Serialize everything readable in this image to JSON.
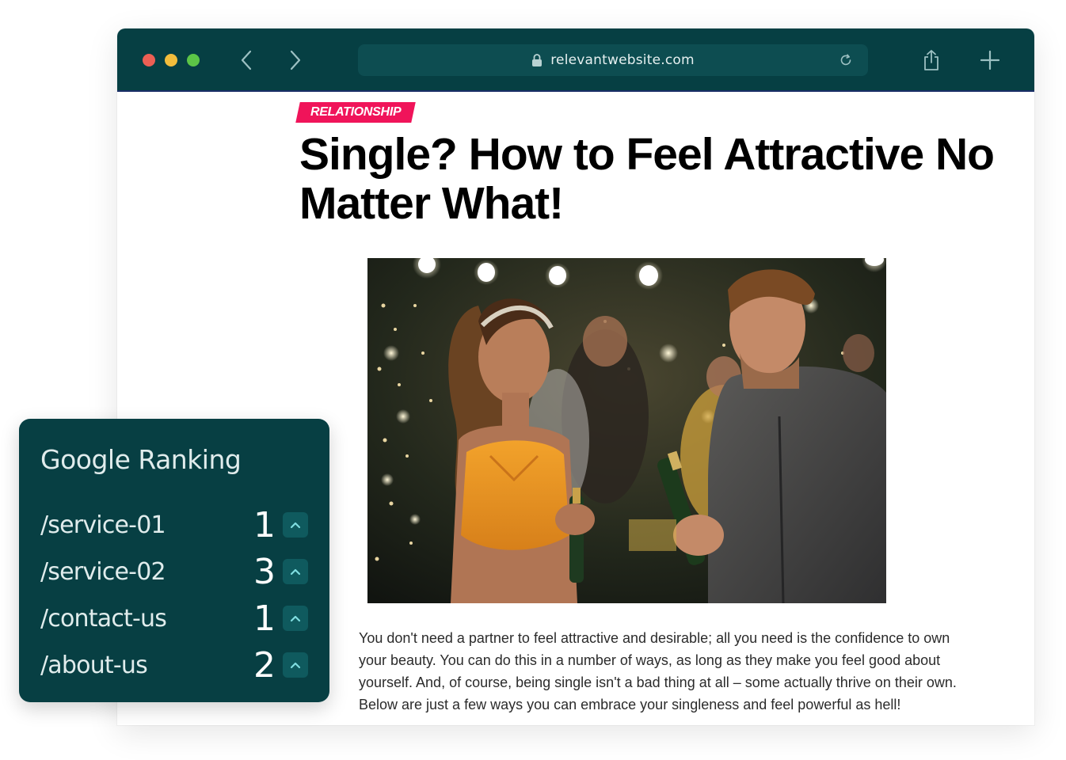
{
  "browser": {
    "url": "relevantwebsite.com",
    "toolbar_color": "#063f43",
    "icons": {
      "back": "chevron-left-icon",
      "forward": "chevron-right-icon",
      "lock": "lock-icon",
      "reload": "reload-icon",
      "share": "share-icon",
      "new_tab": "plus-icon"
    }
  },
  "article": {
    "category": "RELATIONSHIP",
    "category_color": "#f0145a",
    "title": "Single? How to Feel Attractive No Matter What!",
    "body": "You don't need a partner to feel attractive and desirable; all you need is the confidence to own your beauty. You can do this in a number of ways, as long as they make you feel good about yourself. And, of course, being single isn't a bad thing at all – some actually thrive on their own. Below are just a few ways you can embrace your singleness and feel powerful as hell!"
  },
  "ranking": {
    "title": "Google Ranking",
    "rows": [
      {
        "path": "/service-01",
        "rank": "1"
      },
      {
        "path": "/service-02",
        "rank": "3"
      },
      {
        "path": "/contact-us",
        "rank": "1"
      },
      {
        "path": "/about-us",
        "rank": "2"
      }
    ],
    "trend_icon": "chevron-up-icon",
    "accent": "#073f43"
  }
}
